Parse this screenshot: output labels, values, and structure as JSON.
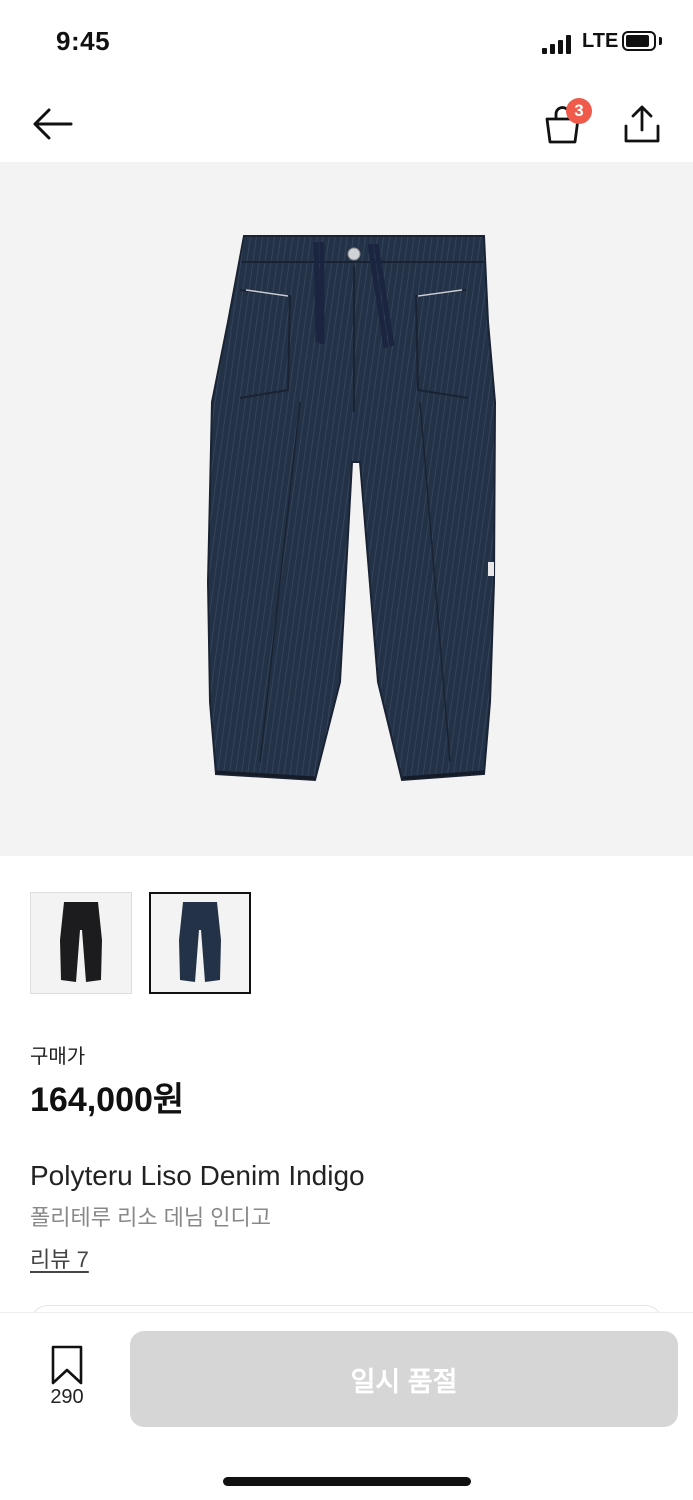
{
  "status_bar": {
    "time": "9:45",
    "network": "LTE"
  },
  "header": {
    "cart_count": "3"
  },
  "product": {
    "price_label": "구매가",
    "price": "164,000원",
    "name_en": "Polyteru Liso Denim Indigo",
    "name_ko": "폴리테루 리소 데님 인디고",
    "review_link": "리뷰 7"
  },
  "thumbnails": [
    {
      "variant": "black",
      "selected": false
    },
    {
      "variant": "indigo",
      "selected": true
    }
  ],
  "bottom_bar": {
    "bookmark_count": "290",
    "action_label": "일시 품절"
  },
  "colors": {
    "badge": "#ef5a4a",
    "disabled_button": "#d6d6d6",
    "hero_background": "#f3f3f3",
    "denim_indigo": "#243247",
    "denim_black": "#1c1c1e"
  },
  "icons": [
    "back-arrow-icon",
    "shopping-bag-icon",
    "share-icon",
    "bookmark-icon"
  ]
}
